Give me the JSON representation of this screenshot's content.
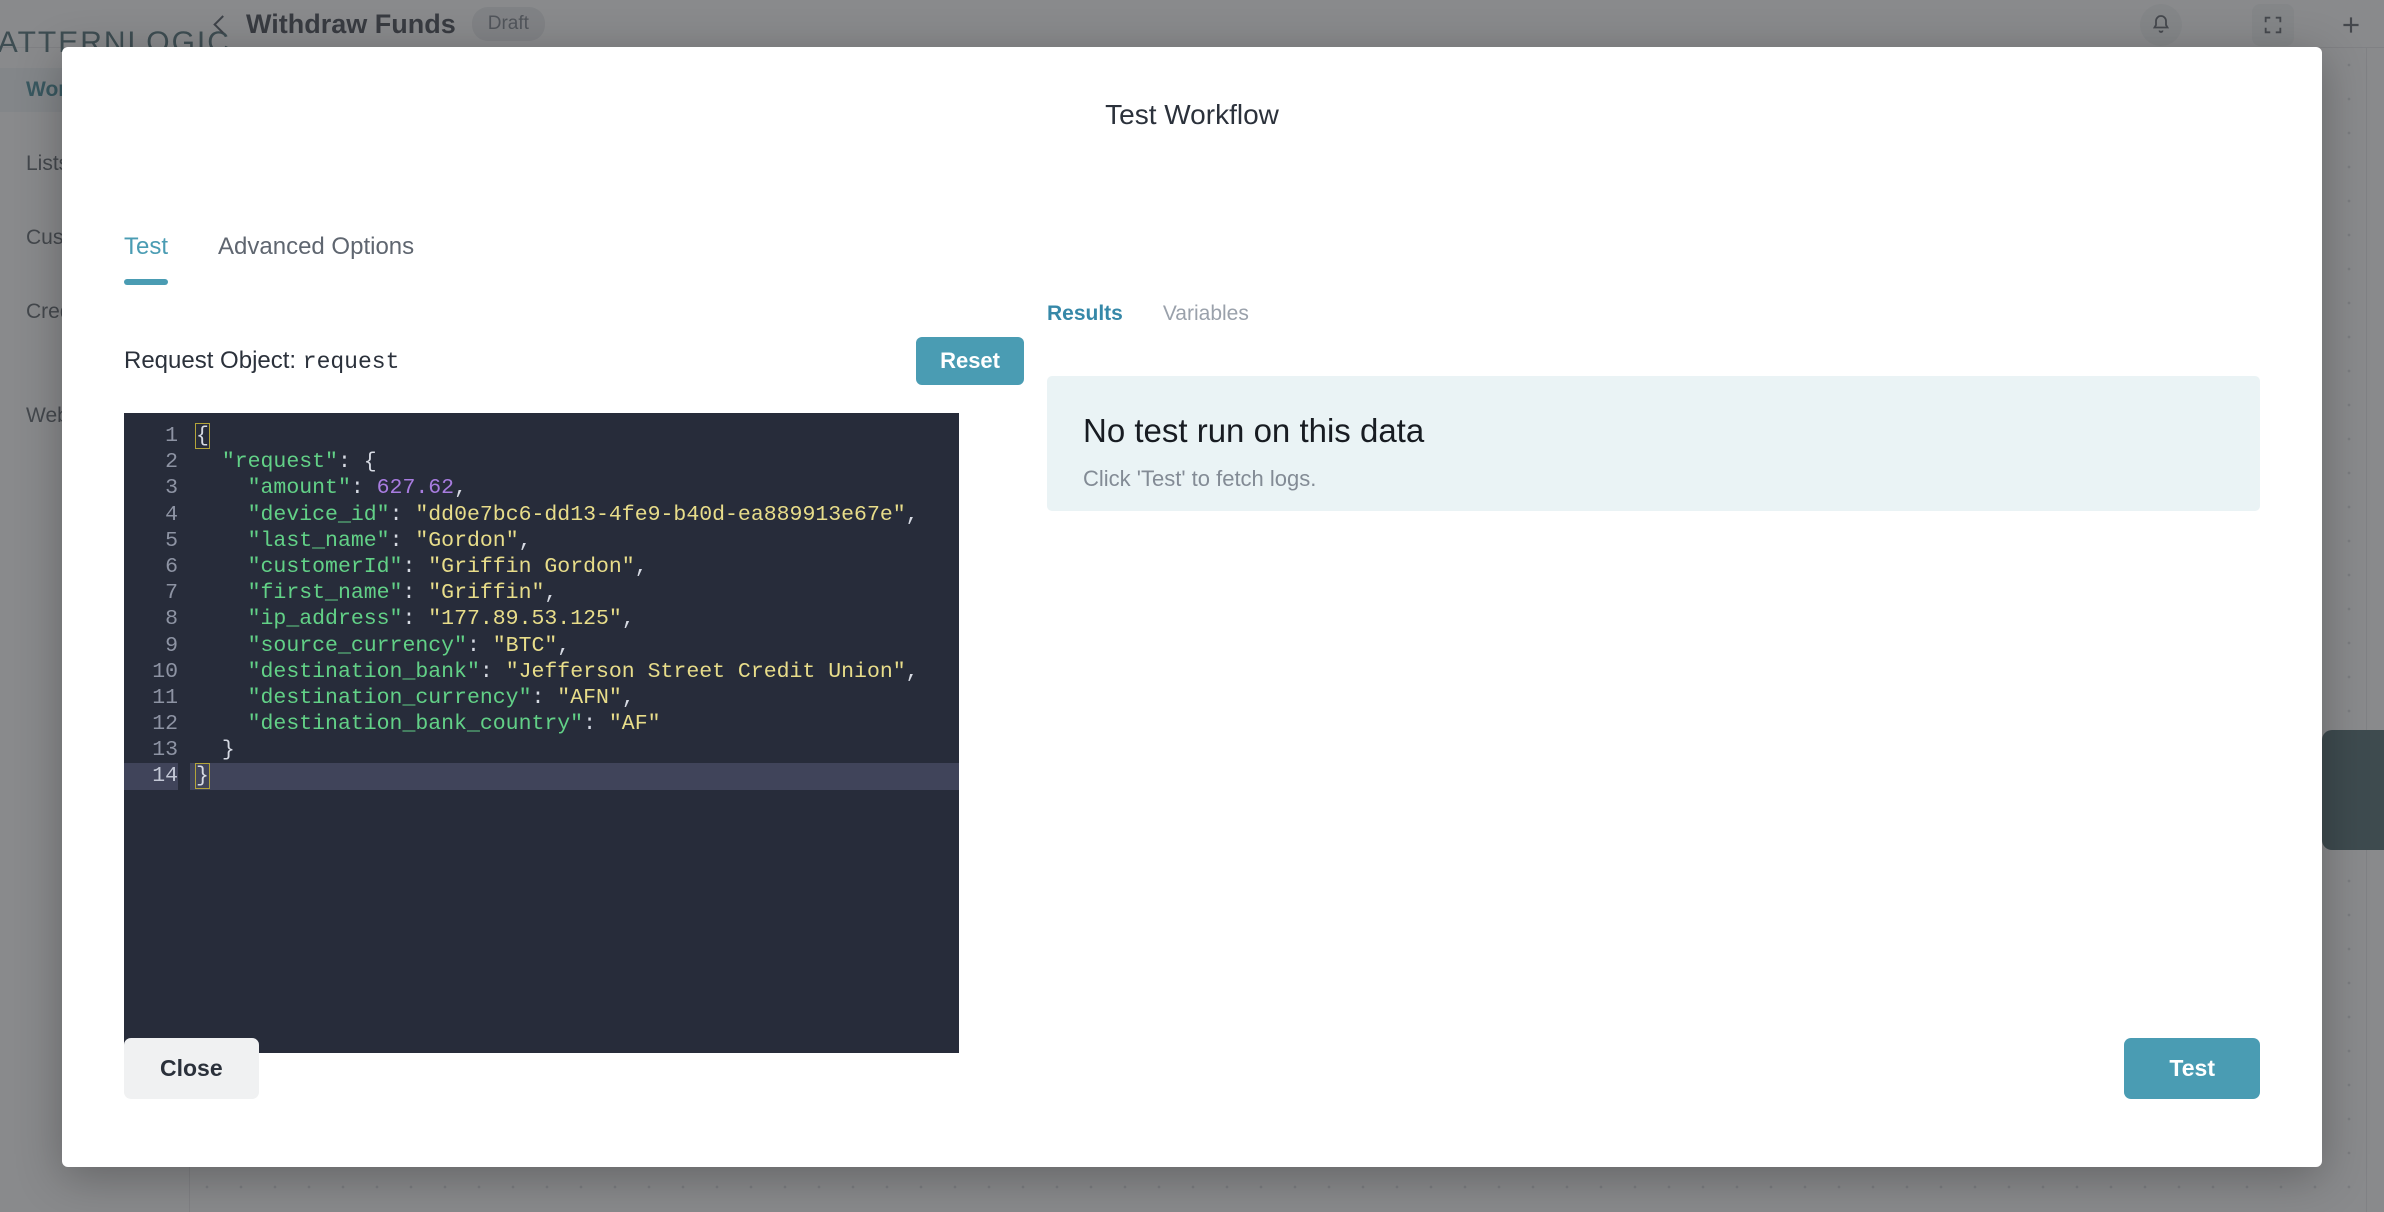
{
  "background": {
    "logo_text": "PATTERNLOGIC",
    "workflow_title": "Withdraw Funds",
    "status_badge": "Draft",
    "back_icon": "chevron-left-icon",
    "top_icons": [
      "bell-icon",
      "expand-icon",
      "plus-icon"
    ],
    "sidebar_items": [
      {
        "label": "Workflows",
        "active": true
      },
      {
        "label": "Lists",
        "active": false
      },
      {
        "label": "Customers",
        "active": false
      },
      {
        "label": "Credentials",
        "active": false
      },
      {
        "label": "Webhooks",
        "active": false
      }
    ]
  },
  "modal": {
    "title": "Test Workflow",
    "tabs": [
      {
        "label": "Test",
        "active": true
      },
      {
        "label": "Advanced Options",
        "active": false
      }
    ],
    "request_label": "Request Object: ",
    "request_object": "request",
    "reset_label": "Reset",
    "close_label": "Close",
    "test_label": "Test"
  },
  "editor": {
    "line_numbers": [
      "1",
      "2",
      "3",
      "4",
      "5",
      "6",
      "7",
      "8",
      "9",
      "10",
      "11",
      "12",
      "13",
      "14"
    ],
    "current_line": 14,
    "lines": [
      {
        "n": "1",
        "text": "{"
      },
      {
        "n": "2",
        "text": "  \"request\": {"
      },
      {
        "n": "3",
        "text": "    \"amount\": 627.62,"
      },
      {
        "n": "4",
        "text": "    \"device_id\": \"dd0e7bc6-dd13-4fe9-b40d-ea889913e67e\","
      },
      {
        "n": "5",
        "text": "    \"last_name\": \"Gordon\","
      },
      {
        "n": "6",
        "text": "    \"customerId\": \"Griffin Gordon\","
      },
      {
        "n": "7",
        "text": "    \"first_name\": \"Griffin\","
      },
      {
        "n": "8",
        "text": "    \"ip_address\": \"177.89.53.125\","
      },
      {
        "n": "9",
        "text": "    \"source_currency\": \"BTC\","
      },
      {
        "n": "10",
        "text": "    \"destination_bank\": \"Jefferson Street Credit Union\","
      },
      {
        "n": "11",
        "text": "    \"destination_currency\": \"AFN\","
      },
      {
        "n": "12",
        "text": "    \"destination_bank_country\": \"AF\""
      },
      {
        "n": "13",
        "text": "  }"
      },
      {
        "n": "14",
        "text": "}"
      }
    ],
    "values": {
      "amount": "627.62",
      "device_id": "dd0e7bc6-dd13-4fe9-b40d-ea889913e67e",
      "last_name": "Gordon",
      "customerId": "Griffin Gordon",
      "first_name": "Griffin",
      "ip_address": "177.89.53.125",
      "source_currency": "BTC",
      "destination_bank": "Jefferson Street Credit Union",
      "destination_currency": "AFN",
      "destination_bank_country": "AF"
    },
    "colors": {
      "background": "#272c3a",
      "key": "#62d187",
      "string": "#e8dd8a",
      "number": "#a87ce0",
      "gutter": "#8d93a3",
      "active_line": "#40445a"
    }
  },
  "results": {
    "tabs": [
      {
        "label": "Results",
        "active": true
      },
      {
        "label": "Variables",
        "active": false
      }
    ],
    "empty_title": "No test run on this data",
    "empty_subtitle": "Click 'Test' to fetch logs."
  },
  "colors": {
    "accent": "#4a9cb3",
    "accent_dark": "#3688a8",
    "card_bg": "#eaf3f5",
    "scrim": "rgba(64,66,70,0.62)"
  }
}
